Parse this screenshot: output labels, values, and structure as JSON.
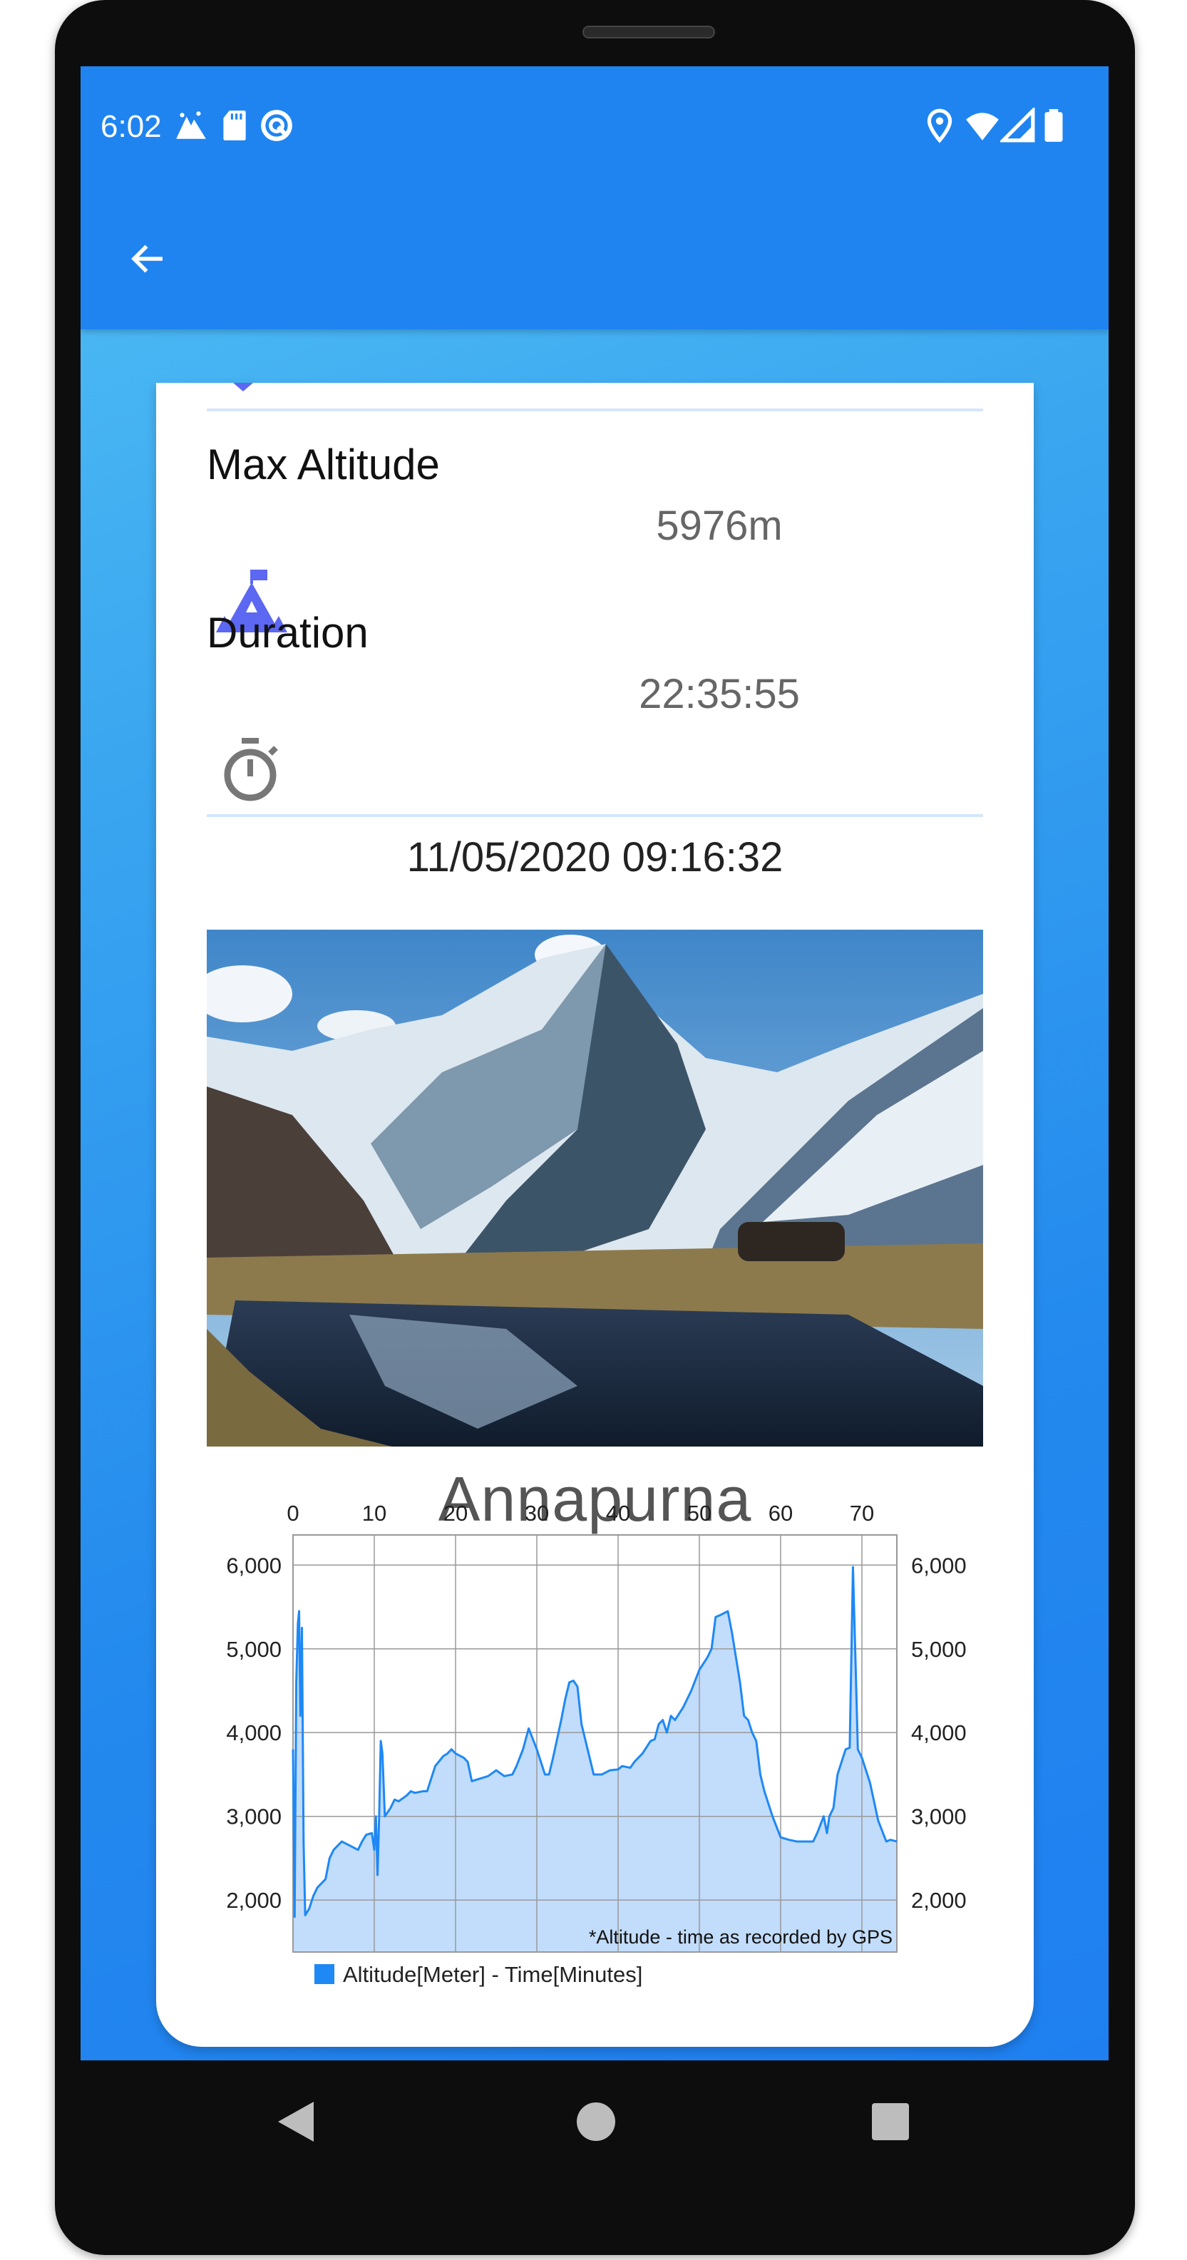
{
  "status_bar": {
    "time": "6:02",
    "left_icons": [
      "mountain-notification-icon",
      "sd-card-icon",
      "circle-q-icon"
    ],
    "right_icons": [
      "location-icon",
      "wifi-icon",
      "signal-icon",
      "battery-icon"
    ]
  },
  "app_bar": {
    "back_icon": "arrow-left-icon"
  },
  "stats": {
    "max_altitude_label": "Max Altitude",
    "max_altitude_value": "5976m",
    "max_altitude_icon": "mountain-flag-icon",
    "duration_label": "Duration",
    "duration_value": "22:35:55",
    "duration_icon": "stopwatch-icon",
    "date": "11/05/2020 09:16:32"
  },
  "photo": {
    "subject": "mountain-lake-photo"
  },
  "trek_title": "Annapurna",
  "colors": {
    "accent": "#1f84f0",
    "line": "#1e88f5",
    "fill": "#c2dcfb",
    "icon": "#5c67f2"
  },
  "chart_data": {
    "type": "area",
    "xlim": [
      0,
      74.3
    ],
    "ylim": [
      1380,
      6360
    ],
    "x_ticks": [
      "0",
      "10",
      "20",
      "30",
      "40",
      "50",
      "60",
      "70"
    ],
    "y_ticks_left": [
      "6,000",
      "5,000",
      "4,000",
      "3,000",
      "2,000"
    ],
    "y_ticks_right": [
      "6,000",
      "5,000",
      "4,000",
      "3,000",
      "2,000"
    ],
    "x_axis_position": "top",
    "grid": true,
    "legend": "bottom-left",
    "annotation": "*Altitude - time as recorded by GPS",
    "series": [
      {
        "name": "Altitude[Meter] - Time[Minutes]",
        "x": [
          0,
          0.2,
          0.4,
          0.6,
          0.75,
          0.9,
          1.1,
          1.3,
          1.5,
          2,
          2.5,
          3,
          4,
          4.5,
          5,
          5.5,
          6,
          7,
          8,
          8.5,
          9,
          9.7,
          10,
          10.2,
          10.4,
          10.6,
          10.8,
          11,
          11.3,
          12,
          12.5,
          13,
          14,
          14.5,
          15,
          16,
          16.5,
          17.5,
          18.5,
          19,
          19.5,
          20,
          21,
          21.5,
          22,
          23,
          24,
          25,
          26,
          27,
          27.5,
          28.3,
          29,
          30,
          31,
          31.5,
          32,
          33,
          33.5,
          34,
          34.5,
          35,
          35.5,
          36.5,
          37,
          38,
          39,
          40,
          40.5,
          41.5,
          42,
          43,
          44,
          44.5,
          45,
          45.5,
          46,
          46.5,
          47,
          48,
          49,
          50,
          51,
          51.5,
          52,
          52.5,
          53.5,
          54,
          54.5,
          55,
          55.5,
          56,
          56.5,
          57,
          57.5,
          58,
          59,
          60,
          61,
          62,
          63,
          64,
          64.5,
          65.3,
          65.7,
          66,
          66.5,
          67,
          68,
          68.5,
          68.7,
          68.9,
          69.2,
          69.5,
          70,
          71,
          72,
          73,
          73.5,
          74.3
        ],
        "y": [
          3800,
          1800,
          4600,
          5300,
          5450,
          4200,
          5250,
          2700,
          1820,
          1900,
          2050,
          2150,
          2250,
          2500,
          2600,
          2650,
          2700,
          2650,
          2600,
          2700,
          2780,
          2800,
          2600,
          3000,
          2300,
          3000,
          3900,
          3750,
          3000,
          3100,
          3200,
          3180,
          3250,
          3300,
          3280,
          3300,
          3300,
          3600,
          3720,
          3750,
          3800,
          3750,
          3700,
          3650,
          3420,
          3450,
          3480,
          3550,
          3480,
          3500,
          3600,
          3800,
          4050,
          3800,
          3500,
          3500,
          3700,
          4150,
          4400,
          4600,
          4620,
          4550,
          4100,
          3700,
          3500,
          3500,
          3550,
          3560,
          3600,
          3580,
          3650,
          3750,
          3900,
          3920,
          4100,
          4150,
          4000,
          4200,
          4150,
          4300,
          4500,
          4750,
          4900,
          5000,
          5380,
          5400,
          5450,
          5200,
          4900,
          4600,
          4200,
          4150,
          4000,
          3900,
          3500,
          3300,
          3000,
          2750,
          2720,
          2700,
          2700,
          2700,
          2800,
          3000,
          2800,
          3000,
          3100,
          3500,
          3800,
          3820,
          4900,
          5976,
          4900,
          3800,
          3700,
          3400,
          2950,
          2700,
          2720,
          2700
        ]
      }
    ]
  },
  "nav_bar": {
    "back": "triangle-back-icon",
    "home": "circle-home-icon",
    "recents": "square-recents-icon"
  }
}
